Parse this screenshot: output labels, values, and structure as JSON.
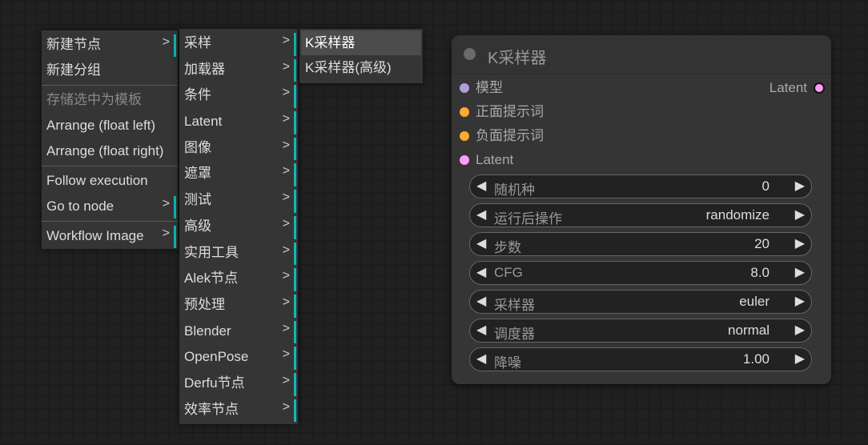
{
  "context_menu": {
    "items": [
      {
        "label": "新建节点",
        "has_submenu": true,
        "disabled": false
      },
      {
        "label": "新建分组",
        "has_submenu": false,
        "disabled": false
      },
      {
        "separator": true
      },
      {
        "label": "存储选中为模板",
        "has_submenu": false,
        "disabled": true
      },
      {
        "label": "Arrange (float left)",
        "has_submenu": false,
        "disabled": false
      },
      {
        "label": "Arrange (float right)",
        "has_submenu": false,
        "disabled": false
      },
      {
        "separator": true
      },
      {
        "label": "Follow execution",
        "has_submenu": false,
        "disabled": false
      },
      {
        "label": "Go to node",
        "has_submenu": true,
        "disabled": false
      },
      {
        "separator": true
      },
      {
        "label": "Workflow Image",
        "has_submenu": true,
        "disabled": false
      }
    ],
    "submenu_arrow": ">"
  },
  "node_category_menu": {
    "items": [
      {
        "label": "采样"
      },
      {
        "label": "加载器"
      },
      {
        "label": "条件"
      },
      {
        "label": "Latent"
      },
      {
        "label": "图像"
      },
      {
        "label": "遮罩"
      },
      {
        "label": "测试"
      },
      {
        "label": "高级"
      },
      {
        "label": "实用工具"
      },
      {
        "label": "Alek节点"
      },
      {
        "label": "预处理"
      },
      {
        "label": "Blender"
      },
      {
        "label": "OpenPose"
      },
      {
        "label": "Derfu节点"
      },
      {
        "label": "效率节点"
      }
    ]
  },
  "sampler_menu": {
    "items": [
      {
        "label": "K采样器",
        "hovered": true
      },
      {
        "label": "K采样器(高级)",
        "hovered": false
      }
    ]
  },
  "node": {
    "title": "K采样器",
    "inputs": [
      {
        "label": "模型",
        "color": "#b39ddb"
      },
      {
        "label": "正面提示词",
        "color": "#ffa931"
      },
      {
        "label": "负面提示词",
        "color": "#ffa931"
      },
      {
        "label": "Latent",
        "color": "#ff9cf9"
      }
    ],
    "outputs": [
      {
        "label": "Latent",
        "color": "#ff9cf9"
      }
    ],
    "widgets": [
      {
        "label": "随机种",
        "value": "0"
      },
      {
        "label": "运行后操作",
        "value": "randomize"
      },
      {
        "label": "步数",
        "value": "20"
      },
      {
        "label": "CFG",
        "value": "8.0"
      },
      {
        "label": "采样器",
        "value": "euler"
      },
      {
        "label": "调度器",
        "value": "normal"
      },
      {
        "label": "降噪",
        "value": "1.00"
      }
    ],
    "left_arrow": "◀",
    "right_arrow": "▶"
  },
  "colors": {
    "accent_bar": "#10b8b8",
    "canvas_bg": "#202020",
    "menu_bg": "#353535"
  }
}
